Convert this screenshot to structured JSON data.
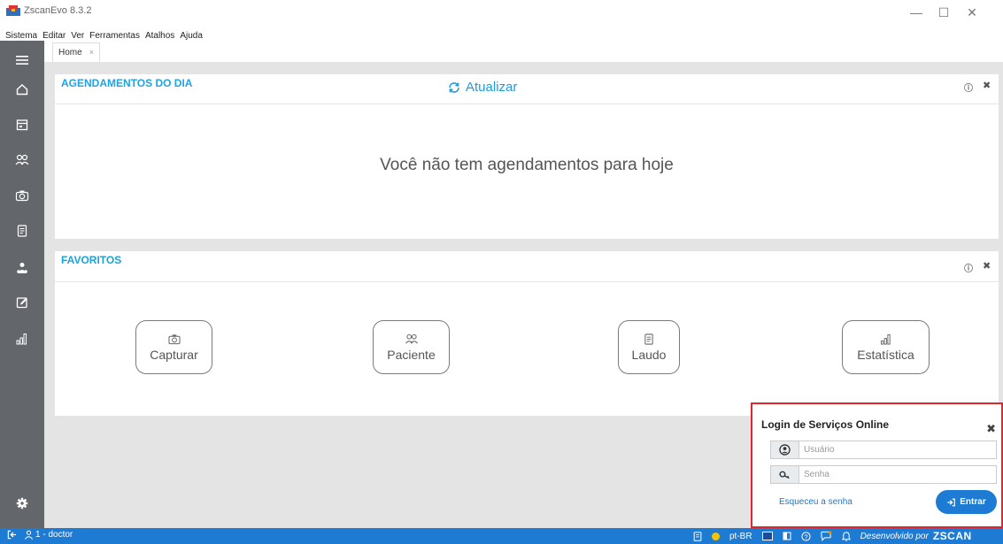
{
  "window": {
    "title": "ZscanEvo 8.3.2",
    "controls": [
      "minimize-icon",
      "maximize-icon",
      "close-icon"
    ]
  },
  "menu": [
    "Sistema",
    "Editar",
    "Ver",
    "Ferramentas",
    "Atalhos",
    "Ajuda"
  ],
  "sidebar": {
    "items": [
      "menu-icon",
      "home-icon",
      "calendar-icon",
      "patients-icon",
      "camera-icon",
      "document-icon",
      "users-icon",
      "edit-icon",
      "stats-icon"
    ],
    "bottom": "settings-icon"
  },
  "tabs": [
    {
      "label": "Home",
      "close": "×"
    }
  ],
  "agendamentos": {
    "title": "AGENDAMENTOS DO DIA",
    "refresh_label": "Atualizar",
    "empty_message": "Você não tem agendamentos para hoje"
  },
  "favoritos": {
    "title": "FAVORITOS",
    "buttons": [
      {
        "label": "Capturar",
        "icon": "camera-icon"
      },
      {
        "label": "Paciente",
        "icon": "patients-icon"
      },
      {
        "label": "Laudo",
        "icon": "document-icon"
      },
      {
        "label": "Estatística",
        "icon": "stats-icon"
      }
    ]
  },
  "login": {
    "title": "Login de Serviços Online",
    "user_placeholder": "Usuário",
    "password_placeholder": "Senha",
    "forgot_label": "Esqueceu a senha",
    "enter_label": "Entrar"
  },
  "statusbar": {
    "user": "1 - doctor",
    "language": "pt-BR",
    "developed_by": "Desenvolvido por",
    "brand": "ZSCAN"
  },
  "colors": {
    "accent": "#1e9be0",
    "sidebar": "#63666a",
    "statusbar": "#1e7bd3",
    "login_border": "#e0282c",
    "enter_button": "#1d7bd4"
  }
}
